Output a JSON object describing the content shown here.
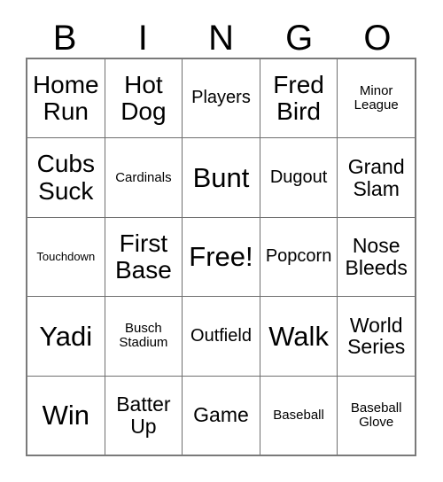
{
  "card": {
    "type": "bingo-card",
    "theme": "baseball",
    "columns": 5,
    "rows": 5,
    "border_color": "#7a7a7a",
    "grid_line_color": "#6f6f6f",
    "background_color": "#ffffff",
    "text_color": "#000000"
  },
  "header": {
    "letters": [
      "B",
      "I",
      "N",
      "G",
      "O"
    ]
  },
  "grid": {
    "rows": [
      {
        "cells": [
          {
            "text": "Home\nRun",
            "size": "sz-lg",
            "free": false
          },
          {
            "text": "Hot\nDog",
            "size": "sz-lg",
            "free": false
          },
          {
            "text": "Players",
            "size": "sz-sm",
            "free": false
          },
          {
            "text": "Fred\nBird",
            "size": "sz-lg",
            "free": false
          },
          {
            "text": "Minor\nLeague",
            "size": "sz-xs",
            "free": false
          }
        ]
      },
      {
        "cells": [
          {
            "text": "Cubs\nSuck",
            "size": "sz-lg",
            "free": false
          },
          {
            "text": "Cardinals",
            "size": "sz-xs",
            "free": false
          },
          {
            "text": "Bunt",
            "size": "sz-xl",
            "free": false
          },
          {
            "text": "Dugout",
            "size": "sz-sm",
            "free": false
          },
          {
            "text": "Grand\nSlam",
            "size": "sz-md",
            "free": false
          }
        ]
      },
      {
        "cells": [
          {
            "text": "Touchdown",
            "size": "sz-xxs",
            "free": false
          },
          {
            "text": "First\nBase",
            "size": "sz-lg",
            "free": false
          },
          {
            "text": "Free!",
            "size": "sz-xl",
            "free": true
          },
          {
            "text": "Popcorn",
            "size": "sz-sm",
            "free": false
          },
          {
            "text": "Nose\nBleeds",
            "size": "sz-md",
            "free": false
          }
        ]
      },
      {
        "cells": [
          {
            "text": "Yadi",
            "size": "sz-xl",
            "free": false
          },
          {
            "text": "Busch\nStadium",
            "size": "sz-xs",
            "free": false
          },
          {
            "text": "Outfield",
            "size": "sz-sm",
            "free": false
          },
          {
            "text": "Walk",
            "size": "sz-xl",
            "free": false
          },
          {
            "text": "World\nSeries",
            "size": "sz-md",
            "free": false
          }
        ]
      },
      {
        "cells": [
          {
            "text": "Win",
            "size": "sz-xl",
            "free": false
          },
          {
            "text": "Batter\nUp",
            "size": "sz-md",
            "free": false
          },
          {
            "text": "Game",
            "size": "sz-md",
            "free": false
          },
          {
            "text": "Baseball",
            "size": "sz-xs",
            "free": false
          },
          {
            "text": "Baseball\nGlove",
            "size": "sz-xs",
            "free": false
          }
        ]
      }
    ]
  }
}
